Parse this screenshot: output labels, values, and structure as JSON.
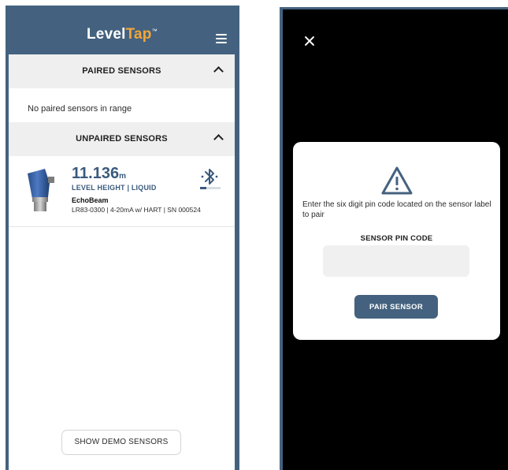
{
  "header": {
    "logo_level": "Level",
    "logo_tap": "Tap",
    "logo_tm": "™"
  },
  "paired_section": {
    "title": "PAIRED SENSORS",
    "empty_text": "No paired sensors in range"
  },
  "unpaired_section": {
    "title": "UNPAIRED SENSORS"
  },
  "sensor": {
    "level_value": "11.136",
    "level_unit": "m",
    "level_label": "LEVEL HEIGHT | LIQUID",
    "name": "EchoBeam",
    "detail": "LR83-0300 | 4-20mA w/ HART | SN 000524",
    "signal_strength": 0.3
  },
  "demo_button": "SHOW DEMO SENSORS",
  "modal": {
    "instruction": "Enter the six digit pin code located on the sensor label to pair",
    "pin_label": "SENSOR PIN CODE",
    "pin_value": "",
    "pair_button": "PAIR SENSOR"
  },
  "colors": {
    "brand_blue": "#44627f",
    "logo_accent": "#f3a638",
    "text_blue": "#3a5a7d"
  },
  "icons": [
    "menu-icon",
    "chevron-up-icon",
    "bluetooth-icon",
    "sensor-device-icon",
    "close-icon",
    "warning-icon"
  ]
}
